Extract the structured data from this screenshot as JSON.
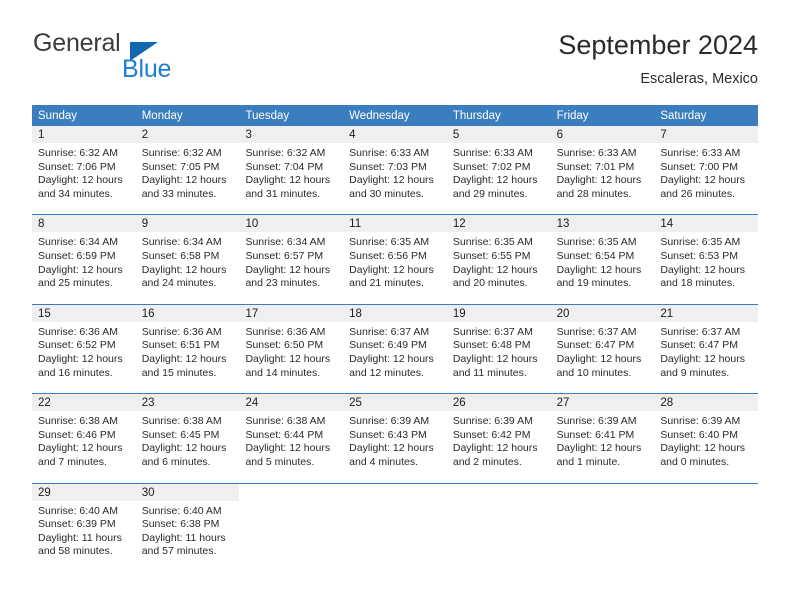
{
  "brand": {
    "name_part1": "General",
    "name_part2": "Blue",
    "triangle_color": "#1466b0",
    "blue_color": "#1d7fd4"
  },
  "header": {
    "title": "September 2024",
    "location": "Escaleras, Mexico"
  },
  "colors": {
    "header_blue": "#3a7ec0",
    "day_band_gray": "#efefef",
    "text": "#2a2a2a"
  },
  "weekday_headers": [
    "Sunday",
    "Monday",
    "Tuesday",
    "Wednesday",
    "Thursday",
    "Friday",
    "Saturday"
  ],
  "labels": {
    "sunrise_prefix": "Sunrise: ",
    "sunset_prefix": "Sunset: ",
    "daylight_prefix": "Daylight: "
  },
  "weeks": [
    {
      "days": [
        {
          "num": "1",
          "sunrise": "Sunrise: 6:32 AM",
          "sunset": "Sunset: 7:06 PM",
          "daylight": "Daylight: 12 hours and 34 minutes."
        },
        {
          "num": "2",
          "sunrise": "Sunrise: 6:32 AM",
          "sunset": "Sunset: 7:05 PM",
          "daylight": "Daylight: 12 hours and 33 minutes."
        },
        {
          "num": "3",
          "sunrise": "Sunrise: 6:32 AM",
          "sunset": "Sunset: 7:04 PM",
          "daylight": "Daylight: 12 hours and 31 minutes."
        },
        {
          "num": "4",
          "sunrise": "Sunrise: 6:33 AM",
          "sunset": "Sunset: 7:03 PM",
          "daylight": "Daylight: 12 hours and 30 minutes."
        },
        {
          "num": "5",
          "sunrise": "Sunrise: 6:33 AM",
          "sunset": "Sunset: 7:02 PM",
          "daylight": "Daylight: 12 hours and 29 minutes."
        },
        {
          "num": "6",
          "sunrise": "Sunrise: 6:33 AM",
          "sunset": "Sunset: 7:01 PM",
          "daylight": "Daylight: 12 hours and 28 minutes."
        },
        {
          "num": "7",
          "sunrise": "Sunrise: 6:33 AM",
          "sunset": "Sunset: 7:00 PM",
          "daylight": "Daylight: 12 hours and 26 minutes."
        }
      ]
    },
    {
      "days": [
        {
          "num": "8",
          "sunrise": "Sunrise: 6:34 AM",
          "sunset": "Sunset: 6:59 PM",
          "daylight": "Daylight: 12 hours and 25 minutes."
        },
        {
          "num": "9",
          "sunrise": "Sunrise: 6:34 AM",
          "sunset": "Sunset: 6:58 PM",
          "daylight": "Daylight: 12 hours and 24 minutes."
        },
        {
          "num": "10",
          "sunrise": "Sunrise: 6:34 AM",
          "sunset": "Sunset: 6:57 PM",
          "daylight": "Daylight: 12 hours and 23 minutes."
        },
        {
          "num": "11",
          "sunrise": "Sunrise: 6:35 AM",
          "sunset": "Sunset: 6:56 PM",
          "daylight": "Daylight: 12 hours and 21 minutes."
        },
        {
          "num": "12",
          "sunrise": "Sunrise: 6:35 AM",
          "sunset": "Sunset: 6:55 PM",
          "daylight": "Daylight: 12 hours and 20 minutes."
        },
        {
          "num": "13",
          "sunrise": "Sunrise: 6:35 AM",
          "sunset": "Sunset: 6:54 PM",
          "daylight": "Daylight: 12 hours and 19 minutes."
        },
        {
          "num": "14",
          "sunrise": "Sunrise: 6:35 AM",
          "sunset": "Sunset: 6:53 PM",
          "daylight": "Daylight: 12 hours and 18 minutes."
        }
      ]
    },
    {
      "days": [
        {
          "num": "15",
          "sunrise": "Sunrise: 6:36 AM",
          "sunset": "Sunset: 6:52 PM",
          "daylight": "Daylight: 12 hours and 16 minutes."
        },
        {
          "num": "16",
          "sunrise": "Sunrise: 6:36 AM",
          "sunset": "Sunset: 6:51 PM",
          "daylight": "Daylight: 12 hours and 15 minutes."
        },
        {
          "num": "17",
          "sunrise": "Sunrise: 6:36 AM",
          "sunset": "Sunset: 6:50 PM",
          "daylight": "Daylight: 12 hours and 14 minutes."
        },
        {
          "num": "18",
          "sunrise": "Sunrise: 6:37 AM",
          "sunset": "Sunset: 6:49 PM",
          "daylight": "Daylight: 12 hours and 12 minutes."
        },
        {
          "num": "19",
          "sunrise": "Sunrise: 6:37 AM",
          "sunset": "Sunset: 6:48 PM",
          "daylight": "Daylight: 12 hours and 11 minutes."
        },
        {
          "num": "20",
          "sunrise": "Sunrise: 6:37 AM",
          "sunset": "Sunset: 6:47 PM",
          "daylight": "Daylight: 12 hours and 10 minutes."
        },
        {
          "num": "21",
          "sunrise": "Sunrise: 6:37 AM",
          "sunset": "Sunset: 6:47 PM",
          "daylight": "Daylight: 12 hours and 9 minutes."
        }
      ]
    },
    {
      "days": [
        {
          "num": "22",
          "sunrise": "Sunrise: 6:38 AM",
          "sunset": "Sunset: 6:46 PM",
          "daylight": "Daylight: 12 hours and 7 minutes."
        },
        {
          "num": "23",
          "sunrise": "Sunrise: 6:38 AM",
          "sunset": "Sunset: 6:45 PM",
          "daylight": "Daylight: 12 hours and 6 minutes."
        },
        {
          "num": "24",
          "sunrise": "Sunrise: 6:38 AM",
          "sunset": "Sunset: 6:44 PM",
          "daylight": "Daylight: 12 hours and 5 minutes."
        },
        {
          "num": "25",
          "sunrise": "Sunrise: 6:39 AM",
          "sunset": "Sunset: 6:43 PM",
          "daylight": "Daylight: 12 hours and 4 minutes."
        },
        {
          "num": "26",
          "sunrise": "Sunrise: 6:39 AM",
          "sunset": "Sunset: 6:42 PM",
          "daylight": "Daylight: 12 hours and 2 minutes."
        },
        {
          "num": "27",
          "sunrise": "Sunrise: 6:39 AM",
          "sunset": "Sunset: 6:41 PM",
          "daylight": "Daylight: 12 hours and 1 minute."
        },
        {
          "num": "28",
          "sunrise": "Sunrise: 6:39 AM",
          "sunset": "Sunset: 6:40 PM",
          "daylight": "Daylight: 12 hours and 0 minutes."
        }
      ]
    },
    {
      "days": [
        {
          "num": "29",
          "sunrise": "Sunrise: 6:40 AM",
          "sunset": "Sunset: 6:39 PM",
          "daylight": "Daylight: 11 hours and 58 minutes."
        },
        {
          "num": "30",
          "sunrise": "Sunrise: 6:40 AM",
          "sunset": "Sunset: 6:38 PM",
          "daylight": "Daylight: 11 hours and 57 minutes."
        },
        {
          "num": "",
          "sunrise": "",
          "sunset": "",
          "daylight": ""
        },
        {
          "num": "",
          "sunrise": "",
          "sunset": "",
          "daylight": ""
        },
        {
          "num": "",
          "sunrise": "",
          "sunset": "",
          "daylight": ""
        },
        {
          "num": "",
          "sunrise": "",
          "sunset": "",
          "daylight": ""
        },
        {
          "num": "",
          "sunrise": "",
          "sunset": "",
          "daylight": ""
        }
      ]
    }
  ]
}
